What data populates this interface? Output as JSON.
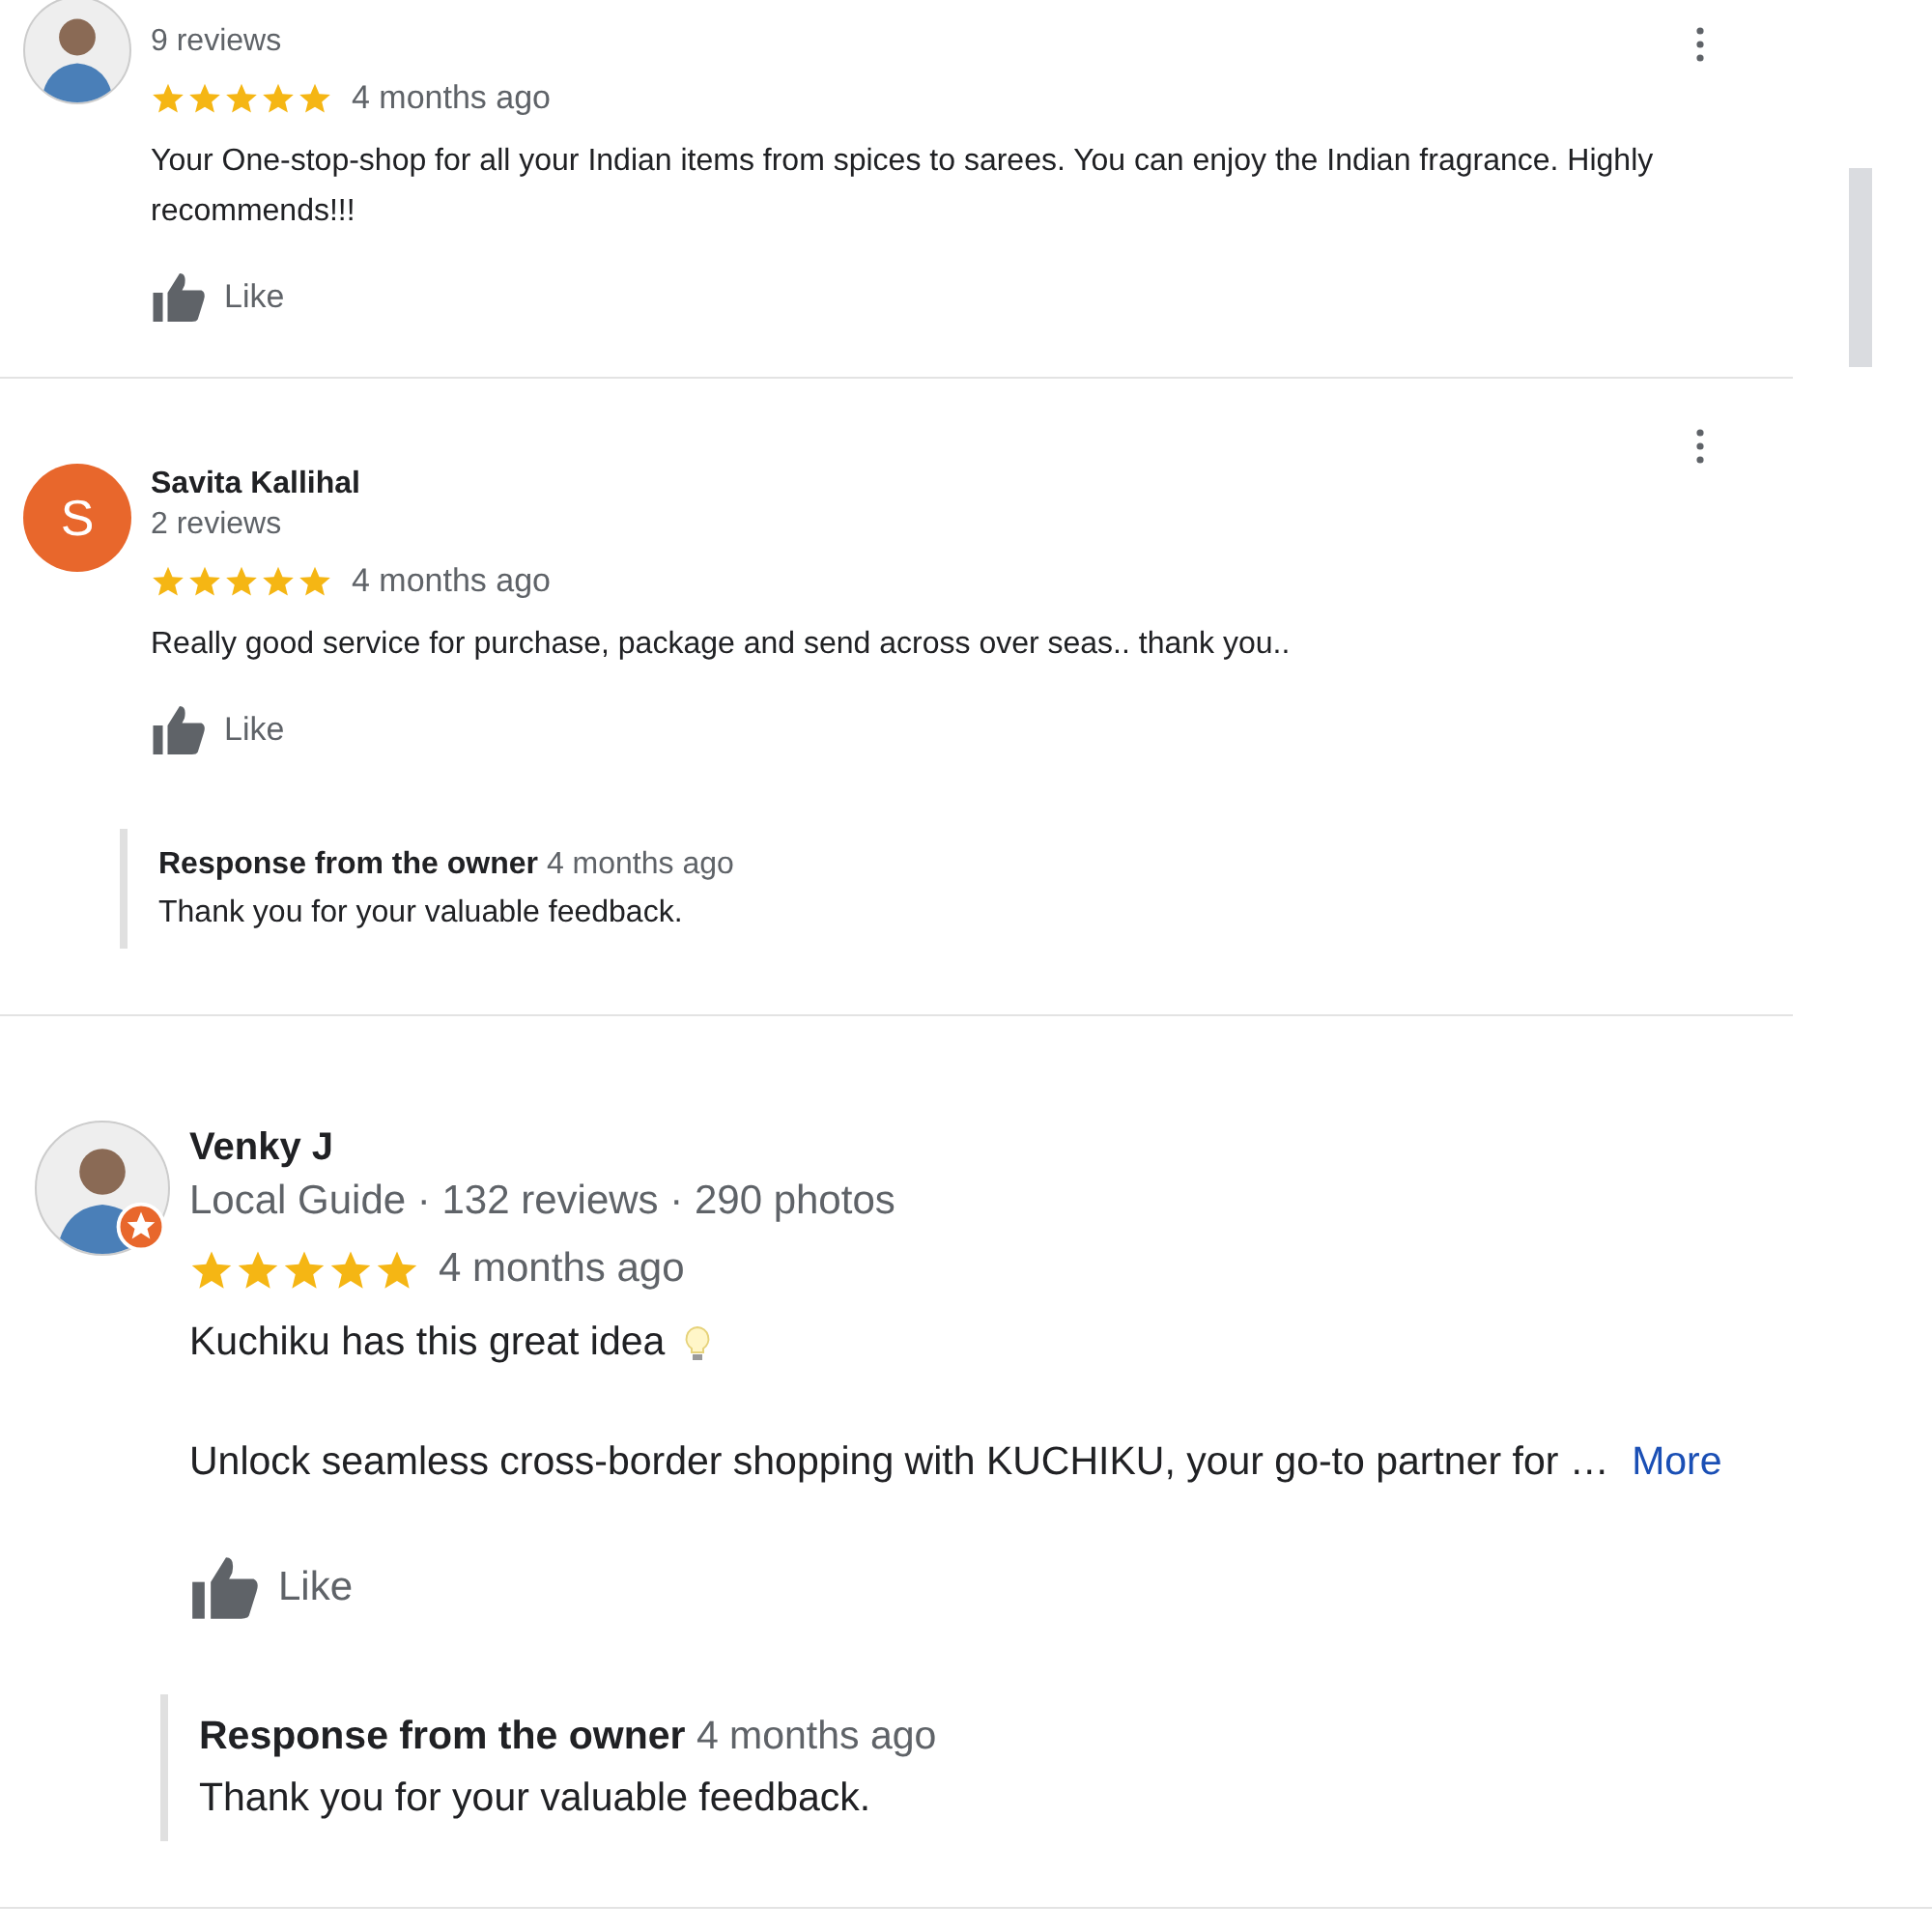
{
  "reviews": [
    {
      "avatar": {
        "kind": "photo"
      },
      "local_guide": false,
      "meta": "9 reviews",
      "stars": 5,
      "time": "4 months ago",
      "body": [
        "Your One-stop-shop for all your Indian items from spices to sarees. You can enjoy the Indian fragrance. Highly recommends!!!"
      ],
      "like": "Like"
    },
    {
      "name": "Savita Kallihal",
      "avatar": {
        "kind": "letter",
        "letter": "S",
        "color": "#e8672c"
      },
      "local_guide": false,
      "meta": "2 reviews",
      "stars": 5,
      "time": "4 months ago",
      "body": [
        "Really good service for purchase, package and send across over seas.. thank you.."
      ],
      "like": "Like",
      "response": {
        "title": "Response from the owner",
        "time": "4 months ago",
        "text": "Thank you for your valuable feedback."
      }
    },
    {
      "name": "Venky J",
      "avatar": {
        "kind": "photo"
      },
      "local_guide": true,
      "meta": "Local Guide · 132 reviews · 290 photos",
      "stars": 5,
      "time": "4 months ago",
      "body": [
        "Kuchiku has this great idea",
        "Unlock seamless cross-border shopping with KUCHIKU, your go-to partner for …"
      ],
      "more": "More",
      "like": "Like",
      "response": {
        "title": "Response from the owner",
        "time": "4 months ago",
        "text": "Thank you for your valuable feedback."
      }
    }
  ]
}
